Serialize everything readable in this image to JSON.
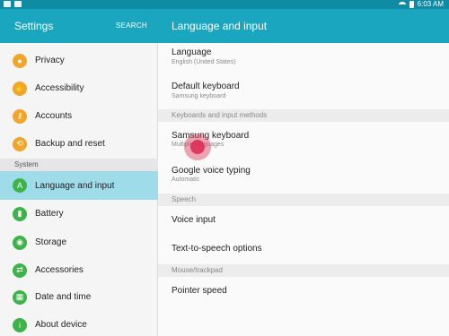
{
  "status_bar": {
    "time": "6:03 AM",
    "icons": [
      "download-icon",
      "screenshot-icon",
      "wifi-icon",
      "battery-icon"
    ]
  },
  "left_header": {
    "title": "Settings",
    "search": "SEARCH"
  },
  "right_header": {
    "title": "Language and input"
  },
  "sidebar": {
    "items": [
      {
        "label": "Privacy",
        "icon": "privacy-icon",
        "color": "#f0a52b"
      },
      {
        "label": "Accessibility",
        "icon": "accessibility-icon",
        "color": "#f0a52b"
      },
      {
        "label": "Accounts",
        "icon": "key-icon",
        "color": "#f0a52b"
      },
      {
        "label": "Backup and reset",
        "icon": "backup-icon",
        "color": "#f0a52b"
      },
      {
        "label": "Language and input",
        "icon": "language-icon",
        "color": "#3db34a",
        "active": true
      },
      {
        "label": "Battery",
        "icon": "battery-icon",
        "color": "#3db34a"
      },
      {
        "label": "Storage",
        "icon": "storage-icon",
        "color": "#3db34a"
      },
      {
        "label": "Accessories",
        "icon": "accessories-icon",
        "color": "#3db34a"
      },
      {
        "label": "Date and time",
        "icon": "calendar-icon",
        "color": "#3db34a"
      },
      {
        "label": "About device",
        "icon": "info-icon",
        "color": "#3db34a"
      }
    ],
    "section_system": "System"
  },
  "content": {
    "language": {
      "title": "Language",
      "subtitle": "English (United States)"
    },
    "default_keyboard": {
      "title": "Default keyboard",
      "subtitle": "Samsung keyboard"
    },
    "section_keyboards": "Keyboards and input methods",
    "samsung_keyboard": {
      "title": "Samsung keyboard",
      "subtitle": "Multiple languages"
    },
    "google_voice": {
      "title": "Google voice typing",
      "subtitle": "Automatic"
    },
    "section_speech": "Speech",
    "voice_input": {
      "title": "Voice input"
    },
    "tts": {
      "title": "Text-to-speech options"
    },
    "section_mouse": "Mouse/trackpad",
    "pointer_speed": {
      "title": "Pointer speed"
    }
  },
  "colors": {
    "header": "#1aa6be",
    "status_bar": "#0f8ba4",
    "active_item": "#9fdcea",
    "orange_icon": "#f0a52b",
    "green_icon": "#3db34a"
  }
}
